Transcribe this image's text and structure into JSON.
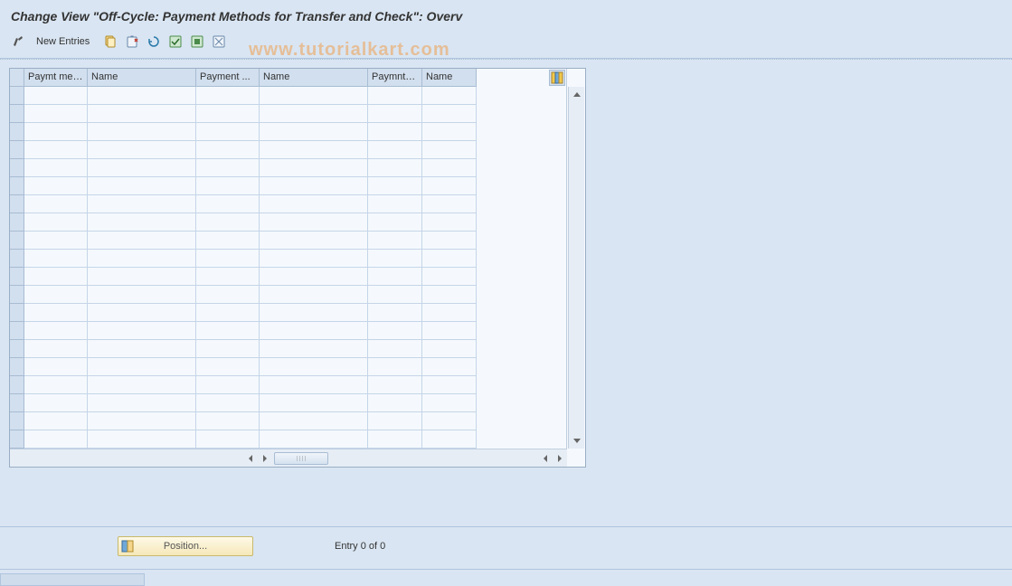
{
  "title": "Change View \"Off-Cycle: Payment Methods for Transfer and Check\": Overv",
  "toolbar": {
    "new_entries": "New Entries"
  },
  "watermark": "www.tutorialkart.com",
  "table": {
    "columns": [
      "Paymt meth....",
      "Name",
      "Payment ...",
      "Name",
      "Paymnt m...",
      "Name"
    ],
    "rows": 20
  },
  "footer": {
    "position_label": "Position...",
    "status": "Entry 0 of 0"
  }
}
